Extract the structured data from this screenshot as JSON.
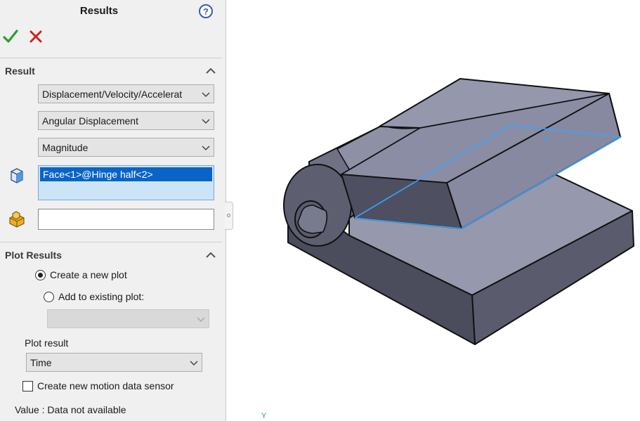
{
  "panel": {
    "title": "Results",
    "help_glyph": "?",
    "ok_icon": "checkmark-icon",
    "cancel_icon": "close-icon",
    "result_section": {
      "heading": "Result",
      "category": "Displacement/Velocity/Accelerat",
      "component": "Angular Displacement",
      "sub_component": "Magnitude",
      "selected_faces": [
        "Face<1>@Hinge half<2>"
      ],
      "reference_selection": ""
    },
    "plot_section": {
      "heading": "Plot Results",
      "create_new_plot": "Create a new plot",
      "add_to_existing": "Add to existing plot:",
      "existing_plot_value": "",
      "plot_result_label": "Plot result",
      "plot_result_value": "Time",
      "sensor_label": "Create new motion data sensor",
      "value_text": "Value : Data not available"
    }
  },
  "viewport": {
    "axis_label": "Y"
  },
  "colors": {
    "accent_blue": "#0a64c8",
    "selection_fill": "#cce4f7",
    "ok_green": "#2d9d2d",
    "cancel_red": "#d22020",
    "model_face_light": "#9a9db3",
    "model_face_dark": "#4e5061",
    "highlight_edge": "#3aa3ff"
  }
}
